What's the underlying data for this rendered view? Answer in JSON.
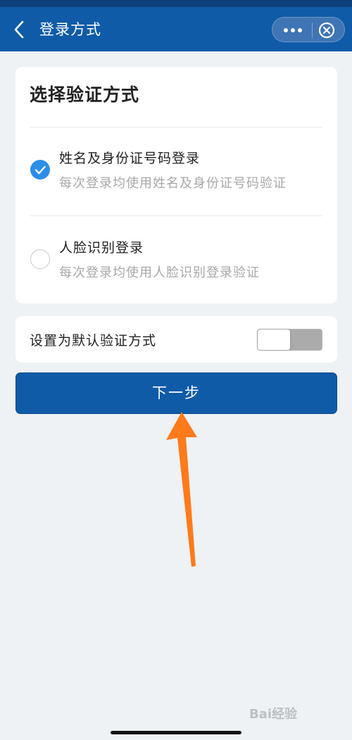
{
  "header": {
    "title": "登录方式",
    "back_icon": "chevron-left-icon",
    "more_icon": "more-dots-icon",
    "close_icon": "close-circle-icon",
    "bg_color": "#0f5ba8"
  },
  "method_card": {
    "title": "选择验证方式",
    "options": [
      {
        "label": "姓名及身份证号码登录",
        "desc": "每次登录均使用姓名及身份证号码验证",
        "checked": true
      },
      {
        "label": "人脸识别登录",
        "desc": "每次登录均使用人脸识别登录验证",
        "checked": false
      }
    ]
  },
  "default_setting": {
    "label": "设置为默认验证方式",
    "toggle_on": false
  },
  "next_button": {
    "label": "下一步",
    "color": "#0f5ba8"
  },
  "annotation": {
    "arrow_color": "#ff7a1a",
    "arrow_icon": "arrow-up-icon"
  },
  "watermark": {
    "text": "Bai经验"
  }
}
